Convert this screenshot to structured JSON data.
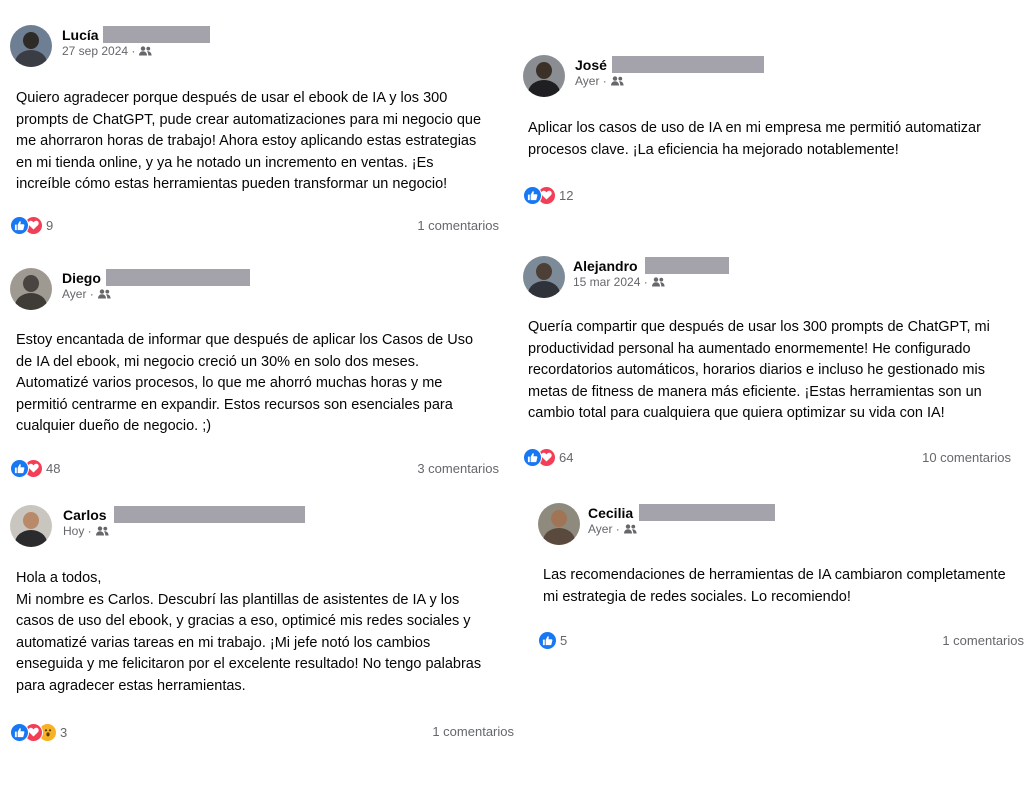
{
  "posts": [
    {
      "name": "Lucía",
      "time": "27 sep 2024 ·",
      "text": "Quiero agradecer porque después de usar el ebook de IA y los 300\nprompts de ChatGPT, pude crear automatizaciones para mi negocio que\nme ahorraron horas de trabajo! Ahora estoy aplicando estas estrategias\nen mi tienda online, y ya he notado un incremento en ventas. ¡Es\nincreíble cómo estas herramientas pueden transformar un negocio!",
      "reaction_count": "9",
      "reactions": [
        "like-icon",
        "love-icon"
      ],
      "comments": "1 comentarios"
    },
    {
      "name": "José",
      "time": "Ayer ·",
      "text": "Aplicar los casos de uso de IA en mi empresa me permitió automatizar\nprocesos clave. ¡La eficiencia ha mejorado notablemente!",
      "reaction_count": "12",
      "reactions": [
        "like-icon",
        "love-icon"
      ],
      "comments": ""
    },
    {
      "name": "Diego",
      "time": "Ayer ·",
      "text": "Estoy encantada de informar que después de aplicar los Casos de Uso\nde IA del ebook, mi negocio creció un 30% en solo dos meses.\nAutomatizé varios procesos, lo que me ahorró muchas horas y me\npermitió centrarme en expandir. Estos recursos son esenciales para\ncualquier dueño de negocio. ;)",
      "reaction_count": "48",
      "reactions": [
        "like-icon",
        "love-icon"
      ],
      "comments": "3 comentarios"
    },
    {
      "name": "Alejandro",
      "time": "15 mar 2024 ·",
      "text": "Quería compartir que después de usar los 300 prompts de ChatGPT, mi\nproductividad personal ha aumentado enormemente! He configurado\nrecordatorios automáticos, horarios diarios e incluso he gestionado mis\nmetas de fitness de manera más eficiente. ¡Estas herramientas son un\ncambio total para cualquiera que quiera optimizar su vida con IA!",
      "reaction_count": "64",
      "reactions": [
        "like-icon",
        "love-icon"
      ],
      "comments": "10 comentarios"
    },
    {
      "name": "Carlos",
      "time": "Hoy ·",
      "text": "Hola a todos,\nMi nombre es Carlos. Descubrí las plantillas de asistentes de IA y los\ncasos de uso del ebook, y gracias a eso, optimicé mis redes sociales y\nautomatizé varias tareas en mi trabajo. ¡Mi jefe notó los cambios\nenseguida y me felicitaron por el excelente resultado! No tengo palabras\npara agradecer estas herramientas.",
      "reaction_count": "3",
      "reactions": [
        "like-icon",
        "love-icon",
        "wow-icon"
      ],
      "comments": "1 comentarios"
    },
    {
      "name": "Cecilia",
      "time": "Ayer ·",
      "text": "Las recomendaciones de herramientas de IA cambiaron completamente\nmi estrategia de redes sociales. Lo recomiendo!",
      "reaction_count": "5",
      "reactions": [
        "like-icon"
      ],
      "comments": "1 comentarios"
    }
  ],
  "colors": {
    "like": "#1877f2",
    "love": "#f33e58",
    "wow": "#f7b125",
    "secondary_text": "#65676b",
    "redaction": "#a4a3ab"
  },
  "icons": {
    "audience": "friends-audience-icon"
  }
}
